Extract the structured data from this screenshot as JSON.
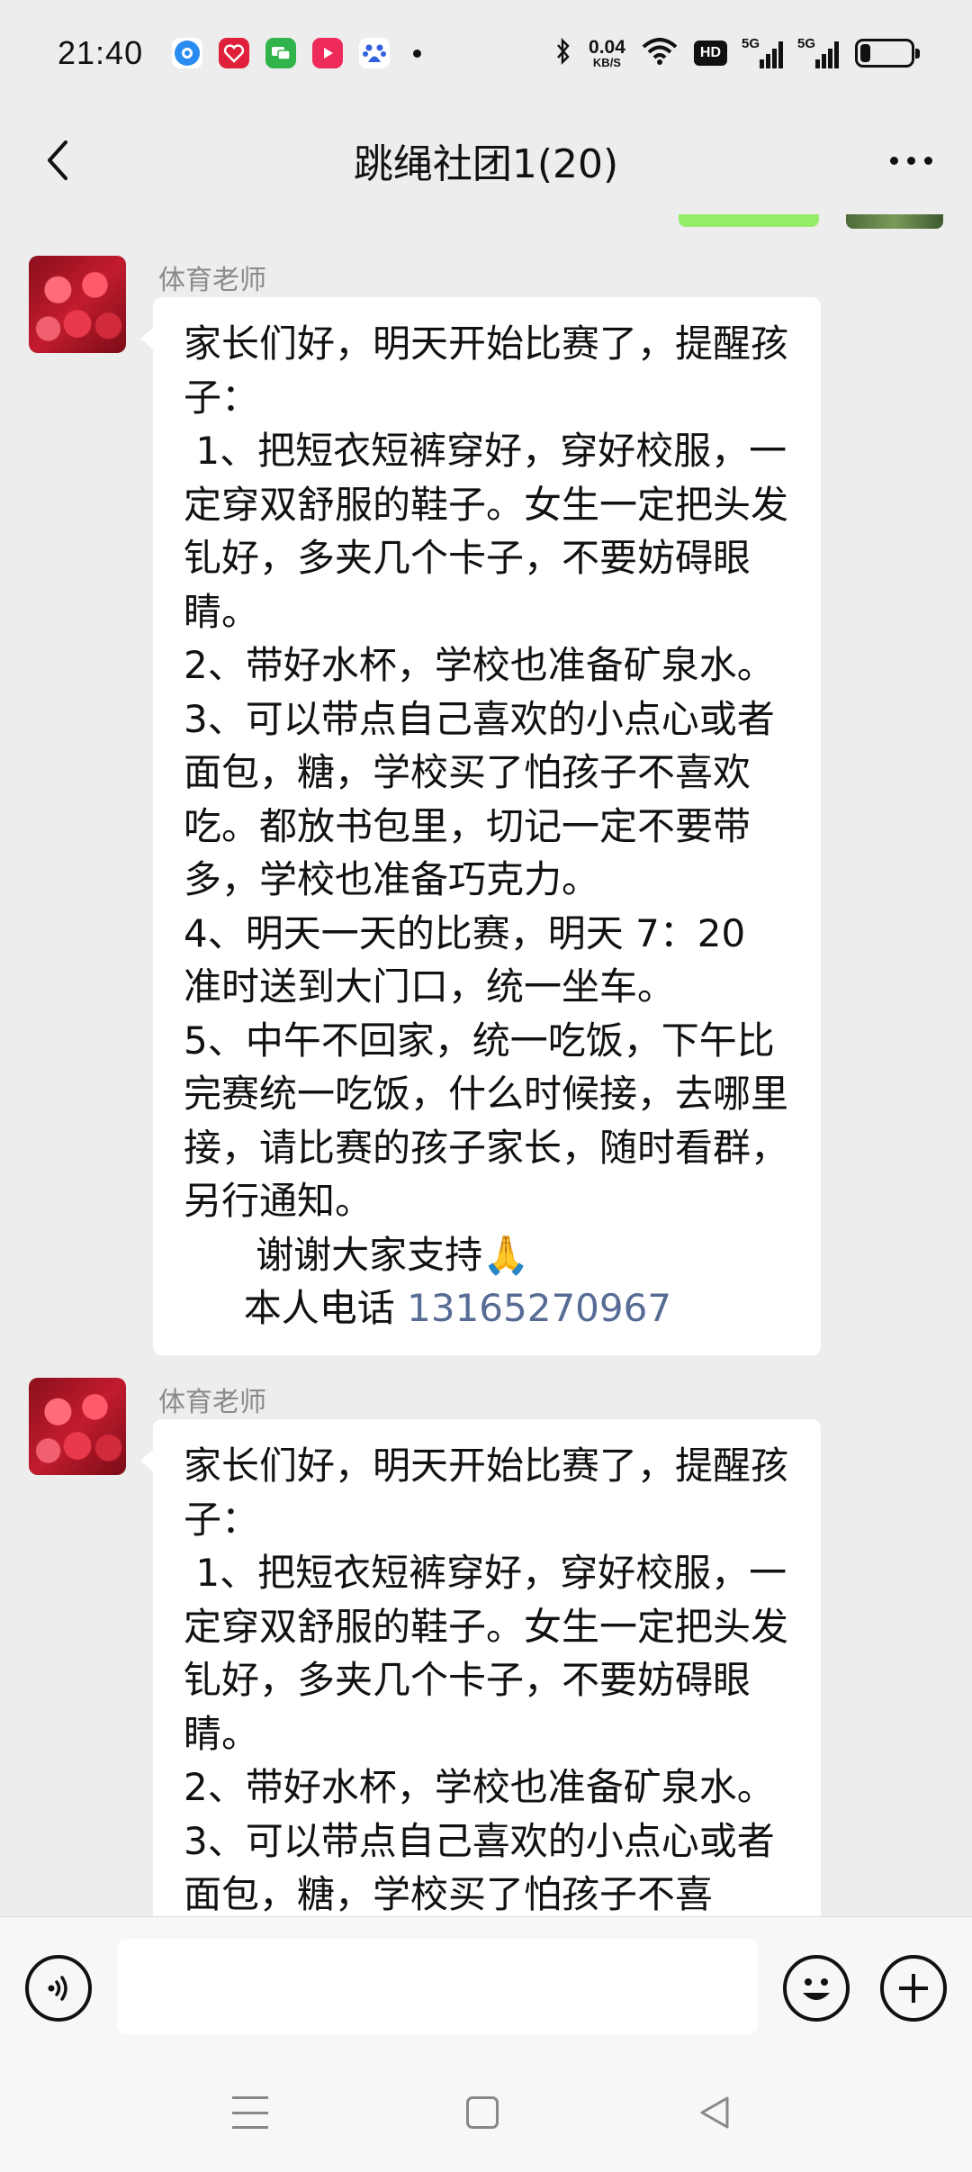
{
  "status_bar": {
    "time": "21:40",
    "net_speed_value": "0.04",
    "net_speed_unit": "KB/S",
    "hd_badge": "HD",
    "signal_1_label": "5G",
    "signal_2_label": "5G",
    "app_icons": [
      "browser-icon",
      "heart-app-icon",
      "messages-app-icon",
      "video-app-icon",
      "baidu-paw-icon"
    ],
    "battery_level": 0.2
  },
  "header": {
    "title": "跳绳社团1(20)"
  },
  "messages": [
    {
      "sender": "体育老师",
      "body": "家长们好，明天开始比赛了，提醒孩子：\n 1、把短衣短裤穿好，穿好校服，一定穿双舒服的鞋子。女生一定把头发钆好，多夹几个卡子，不要妨碍眼睛。\n2、带好水杯，学校也准备矿泉水。\n3、可以带点自己喜欢的小点心或者面包，糖，学校买了怕孩子不喜欢吃。都放书包里，切记一定不要带多，学校也准备巧克力。\n4、明天一天的比赛，明天 7：20 准时送到大门口，统一坐车。\n5、中午不回家，统一吃饭，下午比完赛统一吃饭，什么时候接，去哪里接，请比赛的孩子家长，随时看群，另行通知。\n      谢谢大家支持🙏\n     本人电话 ",
      "phone": "13165270967"
    },
    {
      "sender": "体育老师",
      "body": "家长们好，明天开始比赛了，提醒孩子：\n 1、把短衣短裤穿好，穿好校服，一定穿双舒服的鞋子。女生一定把头发钆好，多夹几个卡子，不要妨碍眼睛。\n2、带好水杯，学校也准备矿泉水。\n3、可以带点自己喜欢的小点心或者面包，糖，学校买了怕孩子不喜"
    }
  ],
  "input_bar": {
    "placeholder": "",
    "icons": [
      "voice-icon",
      "emoji-icon",
      "plus-icon"
    ]
  },
  "nav_bar": {
    "icons": [
      "menu-icon",
      "home-icon",
      "back-triangle-icon"
    ]
  }
}
